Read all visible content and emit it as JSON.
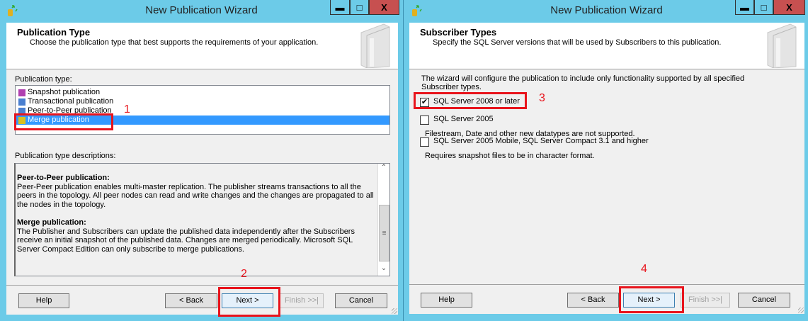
{
  "left_window": {
    "title": "New Publication Wizard",
    "controls": {
      "minimize": "▬",
      "maximize": "□",
      "close": "X"
    },
    "header": {
      "title": "Publication Type",
      "subtitle": "Choose the publication type that best supports the requirements of your application."
    },
    "publication_type_label": "Publication type:",
    "publication_types": [
      {
        "label": "Snapshot publication",
        "icon": "snapshot-icon",
        "selected": false
      },
      {
        "label": "Transactional publication",
        "icon": "transactional-icon",
        "selected": false
      },
      {
        "label": "Peer-to-Peer publication",
        "icon": "peer-to-peer-icon",
        "selected": false
      },
      {
        "label": "Merge publication",
        "icon": "merge-icon",
        "selected": true
      }
    ],
    "descriptions_label": "Publication type descriptions:",
    "descriptions": [
      {
        "heading": "Peer-to-Peer publication:",
        "text": "Peer-Peer publication enables multi-master replication. The publisher streams transactions to all the peers in the topology. All peer nodes can read and write changes and the changes are propagated to all the nodes in the topology."
      },
      {
        "heading": "Merge publication:",
        "text": "The Publisher and Subscribers can update the published data independently after the Subscribers receive an initial snapshot of the published data. Changes are merged periodically. Microsoft SQL Server Compact Edition can only subscribe to merge publications."
      }
    ],
    "buttons": {
      "help": "Help",
      "back": "< Back",
      "next": "Next >",
      "finish": "Finish >>|",
      "cancel": "Cancel"
    },
    "annotations": [
      "1",
      "2"
    ]
  },
  "right_window": {
    "title": "New Publication Wizard",
    "controls": {
      "minimize": "▬",
      "maximize": "□",
      "close": "X"
    },
    "header": {
      "title": "Subscriber Types",
      "subtitle": "Specify the SQL Server versions that will be used by Subscribers to this publication."
    },
    "intro": "The wizard will configure the publication to include only functionality supported by all specified Subscriber types.",
    "options": [
      {
        "label": "SQL Server 2008 or later",
        "checked": true,
        "note": ""
      },
      {
        "label": "SQL Server 2005",
        "checked": false,
        "note": "Filestream, Date and other new datatypes are not supported."
      },
      {
        "label": "SQL Server 2005 Mobile, SQL Server Compact 3.1 and higher",
        "checked": false,
        "note": "Requires snapshot files to be in character format."
      }
    ],
    "buttons": {
      "help": "Help",
      "back": "< Back",
      "next": "Next >",
      "finish": "Finish >>|",
      "cancel": "Cancel"
    },
    "annotations": [
      "3",
      "4"
    ]
  },
  "colors": {
    "titlebar": "#6ccbe8",
    "close_button": "#c75050",
    "selection": "#3399ff",
    "annotation": "#e8141c"
  },
  "checkmark": "✔"
}
